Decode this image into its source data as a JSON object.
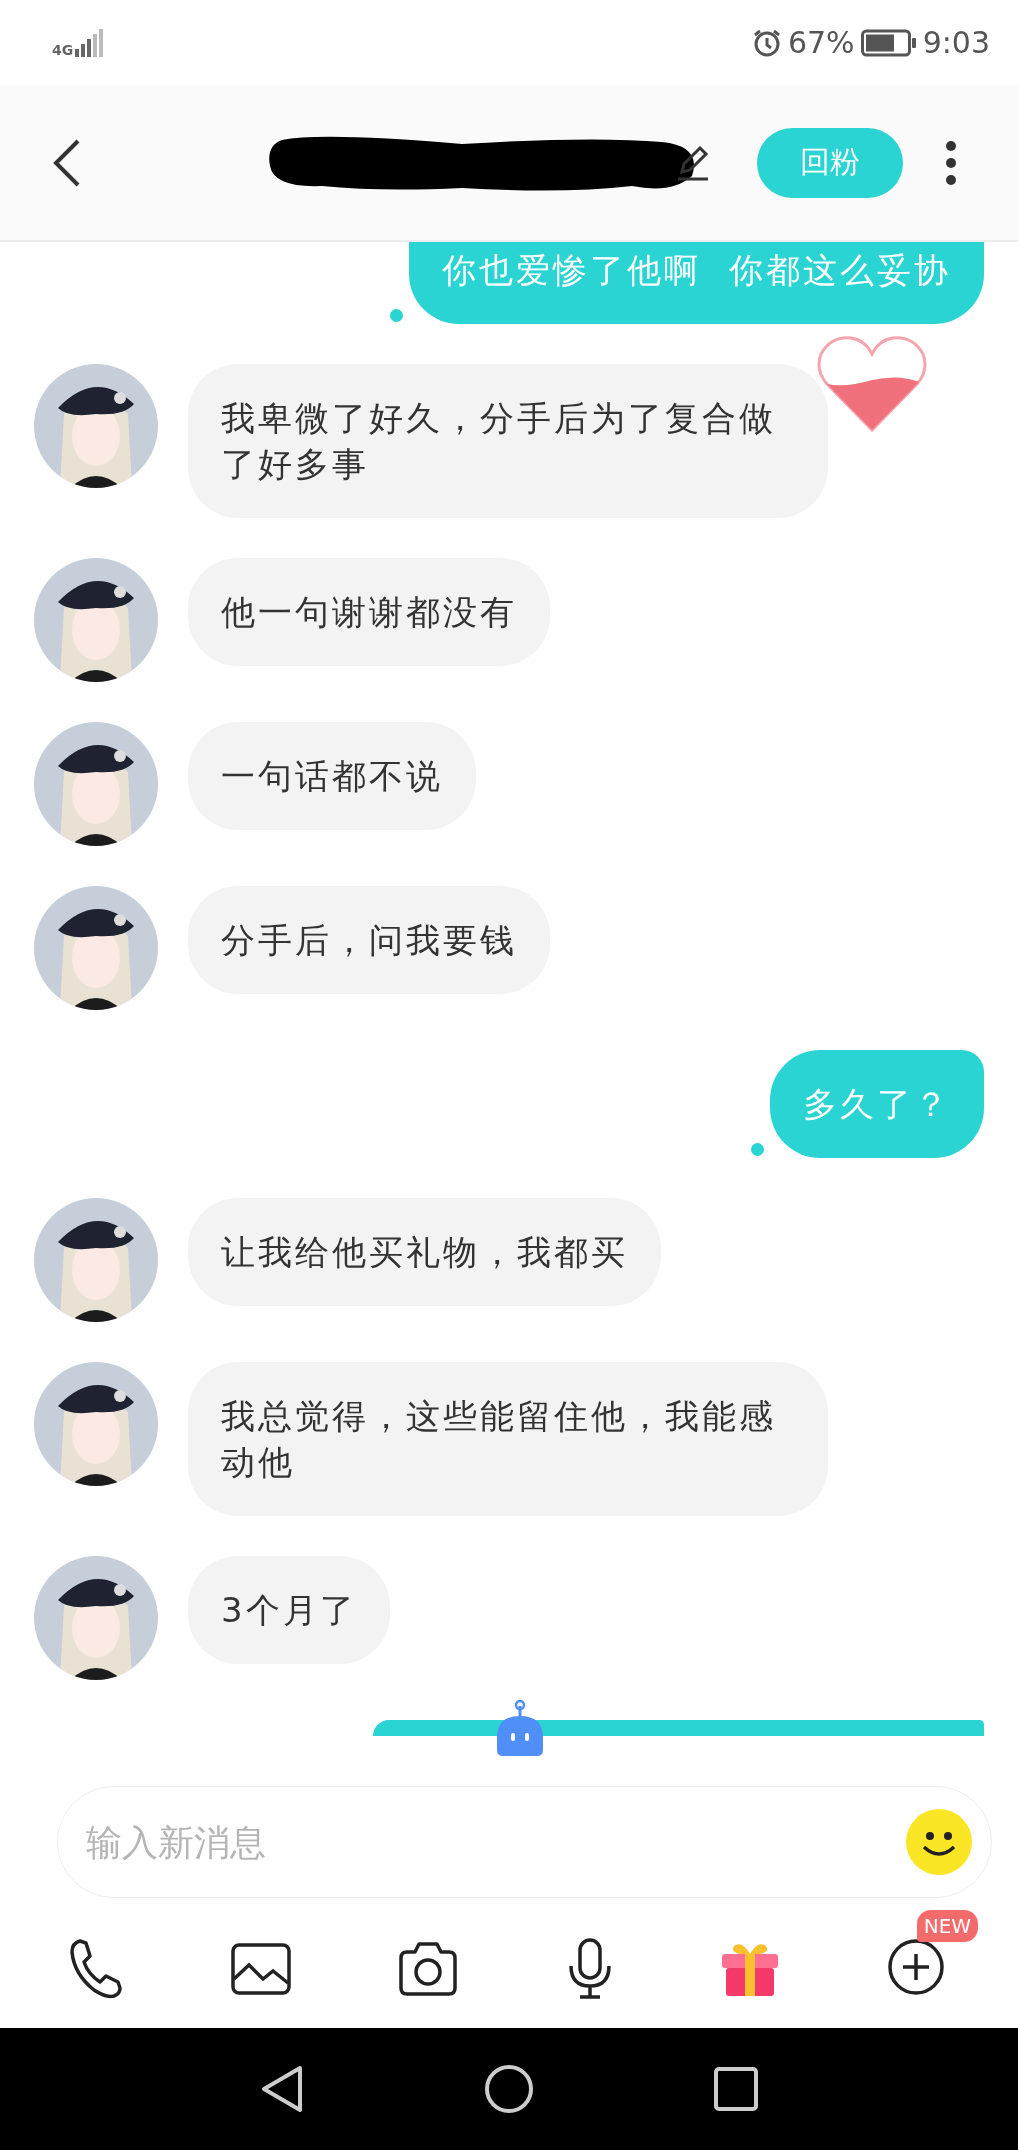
{
  "status_bar": {
    "network": "4G",
    "battery": "67%",
    "time": "9:03"
  },
  "header": {
    "action_button": "回粉"
  },
  "messages": [
    {
      "kind": "sent-cut-top",
      "text": "你也爱惨了他啊  你都这么妥协"
    },
    {
      "kind": "received",
      "text": "我卑微了好久，分手后为了复合做了好多事"
    },
    {
      "kind": "received",
      "text": "他一句谢谢都没有"
    },
    {
      "kind": "received",
      "text": "一句话都不说"
    },
    {
      "kind": "received",
      "text": "分手后，问我要钱"
    },
    {
      "kind": "sent",
      "text": "多久了？"
    },
    {
      "kind": "received",
      "text": "让我给他买礼物，我都买"
    },
    {
      "kind": "received",
      "text": "我总觉得，这些能留住他，我能感动他"
    },
    {
      "kind": "received",
      "text": "3个月了"
    },
    {
      "kind": "sent-cut-bottom"
    }
  ],
  "input": {
    "placeholder": "输入新消息"
  },
  "toolbar": {
    "badge": "NEW"
  }
}
